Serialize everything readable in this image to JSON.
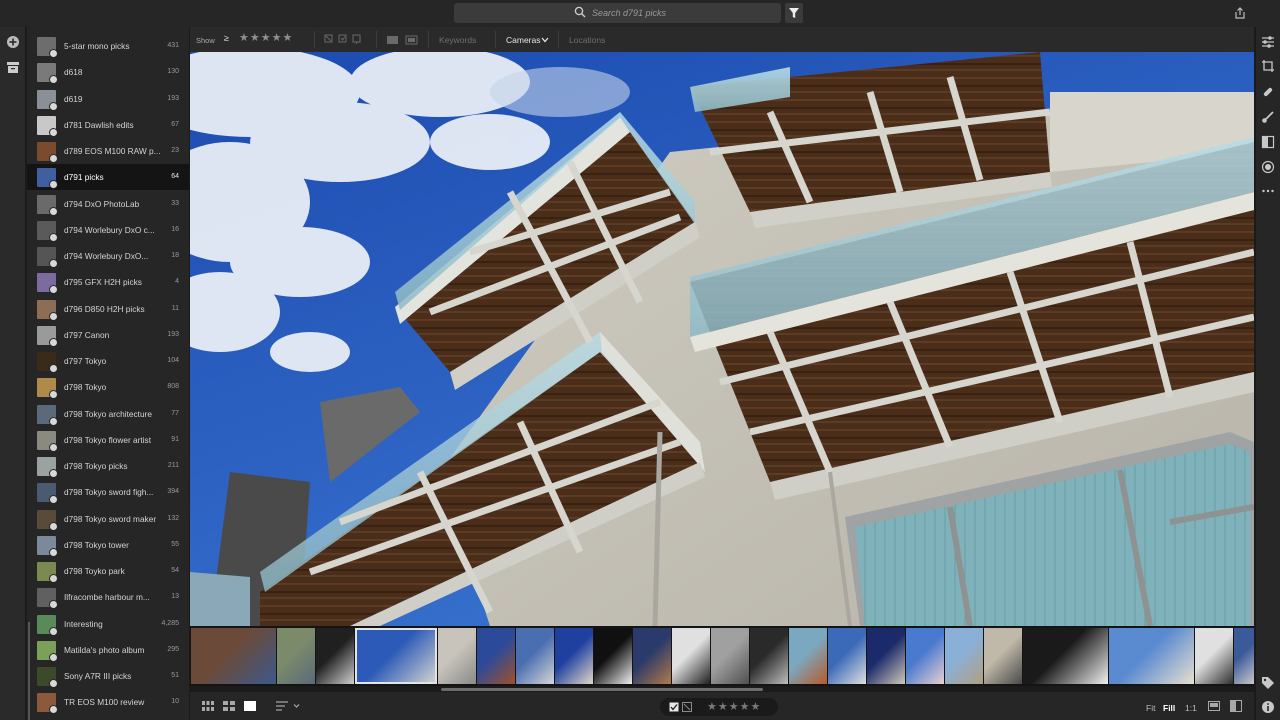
{
  "search": {
    "placeholder": "Search d791 picks"
  },
  "left_rail": {
    "icons": [
      "add-icon",
      "library-icon"
    ]
  },
  "albums": [
    {
      "name": "5-star mono picks",
      "count": "431",
      "thumb": "#6d6d6d"
    },
    {
      "name": "d618",
      "count": "130",
      "thumb": "#7a7a7a"
    },
    {
      "name": "d619",
      "count": "193",
      "thumb": "#8a8f98"
    },
    {
      "name": "d781 Dawlish edits",
      "count": "67",
      "thumb": "#c8c8c8"
    },
    {
      "name": "d789 EOS M100 RAW p...",
      "count": "23",
      "thumb": "#7a4b2d"
    },
    {
      "name": "d791 picks",
      "count": "64",
      "thumb": "#3e5fa0",
      "active": true
    },
    {
      "name": "d794 DxO PhotoLab",
      "count": "33",
      "thumb": "#6a6a6a"
    },
    {
      "name": "d794 Worlebury DxO c...",
      "count": "16",
      "thumb": "#5a5a5a"
    },
    {
      "name": "d794 Worlebury DxO...",
      "count": "18",
      "thumb": "#555555"
    },
    {
      "name": "d795 GFX H2H picks",
      "count": "4",
      "thumb": "#7d6aa0"
    },
    {
      "name": "d796 D850 H2H picks",
      "count": "11",
      "thumb": "#8d6e55"
    },
    {
      "name": "d797 Canon",
      "count": "193",
      "thumb": "#9a9a9a"
    },
    {
      "name": "d797 Tokyo",
      "count": "104",
      "thumb": "#3a2a1a"
    },
    {
      "name": "d798 Tokyo",
      "count": "808",
      "thumb": "#b08a4a"
    },
    {
      "name": "d798 Tokyo architecture",
      "count": "77",
      "thumb": "#5a6a7a"
    },
    {
      "name": "d798 Tokyo flower artist",
      "count": "91",
      "thumb": "#8a8a80"
    },
    {
      "name": "d798 Tokyo picks",
      "count": "211",
      "thumb": "#9aa3a0"
    },
    {
      "name": "d798 Tokyo sword figh...",
      "count": "394",
      "thumb": "#4a5a70"
    },
    {
      "name": "d798 Tokyo sword maker",
      "count": "132",
      "thumb": "#5a4a3a"
    },
    {
      "name": "d798 Tokyo tower",
      "count": "55",
      "thumb": "#7a8a9a"
    },
    {
      "name": "d798 Toyko park",
      "count": "54",
      "thumb": "#7a8a50"
    },
    {
      "name": "Ilfracombe harbour m...",
      "count": "13",
      "thumb": "#606060"
    },
    {
      "name": "Interesting",
      "count": "4,285",
      "thumb": "#5a8a5a"
    },
    {
      "name": "Matilda's photo album",
      "count": "295",
      "thumb": "#7aa05a"
    },
    {
      "name": "Sony A7R III picks",
      "count": "51",
      "thumb": "#3a4a2a"
    },
    {
      "name": "TR EOS M100 review",
      "count": "10",
      "thumb": "#8a5a3a"
    }
  ],
  "filterbar": {
    "show_label": "Show",
    "rating_operator": "≥",
    "rating_stars": "★★★★★",
    "tabs": {
      "keywords": "Keywords",
      "cameras": "Cameras",
      "locations": "Locations"
    }
  },
  "right_rail": {
    "icons": [
      "edit-sliders-icon",
      "crop-icon",
      "healing-icon",
      "brush-icon",
      "linear-gradient-icon",
      "radial-gradient-icon",
      "more-icon",
      "tag-icon",
      "info-icon"
    ]
  },
  "filmstrip": {
    "thumbs": [
      {
        "w": 85,
        "c1": "#6b4a3a",
        "c2": "#3c5a8a"
      },
      {
        "w": 38,
        "c1": "#7a8a6a",
        "c2": "#5a6a7a"
      },
      {
        "w": 38,
        "c1": "#202020",
        "c2": "#d0d0d0"
      },
      {
        "w": 82,
        "c1": "#2c5ab8",
        "c2": "#d8d8d0",
        "selected": true
      },
      {
        "w": 38,
        "c1": "#c8c4bc",
        "c2": "#8a8a88"
      },
      {
        "w": 38,
        "c1": "#2b4a9a",
        "c2": "#a0502a"
      },
      {
        "w": 38,
        "c1": "#4a6fb0",
        "c2": "#d6d6d6"
      },
      {
        "w": 38,
        "c1": "#2040a0",
        "c2": "#e0d8c8"
      },
      {
        "w": 38,
        "c1": "#101010",
        "c2": "#f0f0f0"
      },
      {
        "w": 38,
        "c1": "#2a3a6a",
        "c2": "#b07a4a"
      },
      {
        "w": 38,
        "c1": "#e0e0e0",
        "c2": "#202020"
      },
      {
        "w": 38,
        "c1": "#a0a0a0",
        "c2": "#505050"
      },
      {
        "w": 38,
        "c1": "#2a2a2a",
        "c2": "#bdbdbd"
      },
      {
        "w": 38,
        "c1": "#7aa8c0",
        "c2": "#b85a2a"
      },
      {
        "w": 38,
        "c1": "#3a6ab8",
        "c2": "#e0e0e0"
      },
      {
        "w": 38,
        "c1": "#1a2a6a",
        "c2": "#d0c8b8"
      },
      {
        "w": 38,
        "c1": "#4a7ad0",
        "c2": "#e8d0d0"
      },
      {
        "w": 38,
        "c1": "#8ab0d8",
        "c2": "#b0a080"
      },
      {
        "w": 38,
        "c1": "#c0b8a8",
        "c2": "#4a4a4a"
      },
      {
        "w": 85,
        "c1": "#1a1a1a",
        "c2": "#f0f0f0"
      },
      {
        "w": 85,
        "c1": "#5a8ad0",
        "c2": "#e8e0d0"
      },
      {
        "w": 38,
        "c1": "#e0e0e0",
        "c2": "#303030"
      },
      {
        "w": 20,
        "c1": "#3a5a9a",
        "c2": "#c8c8c8"
      }
    ]
  },
  "bottombar": {
    "rating_stars": "★★★★★",
    "zoom": {
      "fit": "Fit",
      "fill": "Fill",
      "one_to_one": "1:1"
    }
  }
}
